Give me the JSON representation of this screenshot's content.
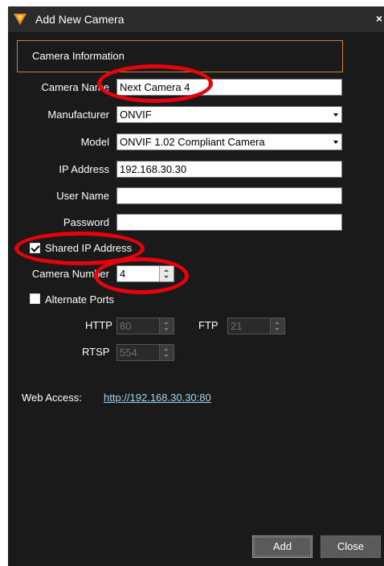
{
  "window": {
    "title": "Add New Camera",
    "close_glyph": "×",
    "icon": "app-logo-icon"
  },
  "section": {
    "title": "Camera Information"
  },
  "fields": {
    "camera_name": {
      "label": "Camera Name",
      "value": "Next Camera 4"
    },
    "manufacturer": {
      "label": "Manufacturer",
      "value": "ONVIF"
    },
    "model": {
      "label": "Model",
      "value": "ONVIF 1.02 Compliant Camera"
    },
    "ip_address": {
      "label": "IP Address",
      "value": "192.168.30.30"
    },
    "user_name": {
      "label": "User Name",
      "value": ""
    },
    "password": {
      "label": "Password",
      "value": ""
    }
  },
  "shared_ip": {
    "label": "Shared IP Address",
    "checked": true
  },
  "camera_number": {
    "label": "Camera Number",
    "value": "4"
  },
  "alternate_ports": {
    "label": "Alternate Ports",
    "checked": false
  },
  "ports": {
    "http": {
      "label": "HTTP",
      "value": "80"
    },
    "ftp": {
      "label": "FTP",
      "value": "21"
    },
    "rtsp": {
      "label": "RTSP",
      "value": "554"
    }
  },
  "web_access": {
    "label": "Web Access:",
    "url": "http://192.168.30.30:80"
  },
  "buttons": {
    "add": "Add",
    "close": "Close"
  },
  "colors": {
    "background": "#1a1a1a",
    "accent_border": "#c8843a",
    "annotation": "#e8000d",
    "link": "#9fd4f2"
  }
}
